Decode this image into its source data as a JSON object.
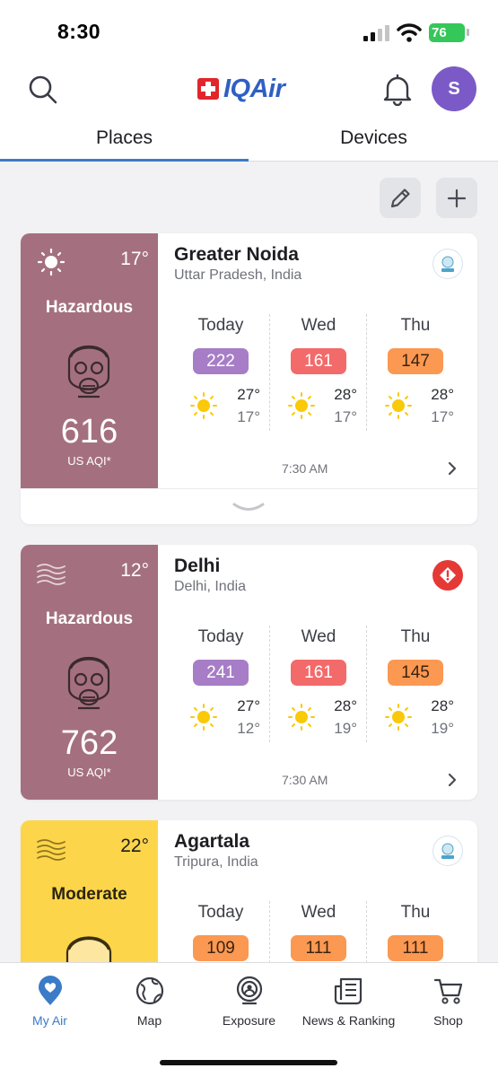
{
  "status_bar": {
    "time": "8:30",
    "battery": "76"
  },
  "header": {
    "logo_text": "IQAir",
    "avatar_initial": "S",
    "tabs": [
      {
        "label": "Places",
        "active": true
      },
      {
        "label": "Devices",
        "active": false
      }
    ]
  },
  "colors": {
    "accent": "#3b7bc8",
    "hazardous": "#a4707f",
    "moderate": "#fdd54a",
    "aqi_purple": "#a67dc6",
    "aqi_red": "#f36a6a",
    "aqi_orange": "#fb9852",
    "logo_red": "#e0262b",
    "logo_blue": "#2f5fc3"
  },
  "places": [
    {
      "name": "Greater Noida",
      "region": "Uttar Pradesh, India",
      "current_temp": "17°",
      "weather_icon": "sun-icon",
      "status": "Hazardous",
      "aqi": "616",
      "aqi_unit": "US AQI*",
      "source_badge": "cpcb-badge",
      "updated": "7:30 AM",
      "forecast": [
        {
          "day": "Today",
          "aqi": "222",
          "high": "27°",
          "low": "17°"
        },
        {
          "day": "Wed",
          "aqi": "161",
          "high": "28°",
          "low": "17°"
        },
        {
          "day": "Thu",
          "aqi": "147",
          "high": "28°",
          "low": "17°"
        }
      ]
    },
    {
      "name": "Delhi",
      "region": "Delhi, India",
      "current_temp": "12°",
      "weather_icon": "haze-icon",
      "status": "Hazardous",
      "aqi": "762",
      "aqi_unit": "US AQI*",
      "source_badge": "alert-icon",
      "updated": "7:30 AM",
      "forecast": [
        {
          "day": "Today",
          "aqi": "241",
          "high": "27°",
          "low": "12°"
        },
        {
          "day": "Wed",
          "aqi": "161",
          "high": "28°",
          "low": "19°"
        },
        {
          "day": "Thu",
          "aqi": "145",
          "high": "28°",
          "low": "19°"
        }
      ]
    },
    {
      "name": "Agartala",
      "region": "Tripura, India",
      "current_temp": "22°",
      "weather_icon": "haze-icon",
      "status": "Moderate",
      "source_badge": "cpcb-badge",
      "forecast": [
        {
          "day": "Today",
          "aqi": "109"
        },
        {
          "day": "Wed",
          "aqi": "111"
        },
        {
          "day": "Thu",
          "aqi": "111"
        }
      ]
    }
  ],
  "bottom_nav": [
    {
      "label": "My Air",
      "icon": "heart-pin-icon",
      "active": true
    },
    {
      "label": "Map",
      "icon": "globe-icon",
      "active": false
    },
    {
      "label": "Exposure",
      "icon": "exposure-icon",
      "active": false
    },
    {
      "label": "News & Ranking",
      "icon": "news-icon",
      "active": false
    },
    {
      "label": "Shop",
      "icon": "cart-icon",
      "active": false
    }
  ]
}
